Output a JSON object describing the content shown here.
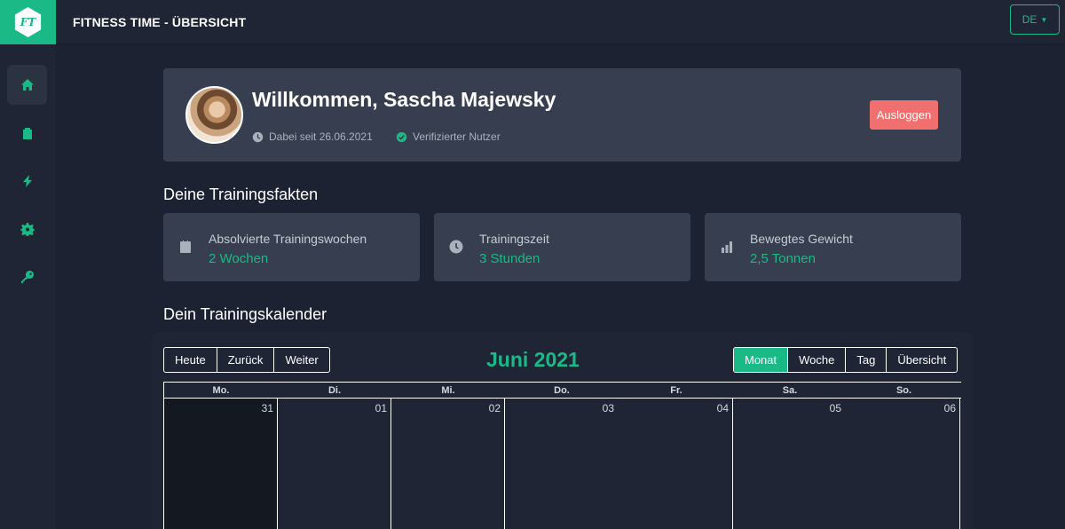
{
  "app": {
    "logo_text": "FT",
    "title": "FITNESS TIME - ÜBERSICHT",
    "language": "DE"
  },
  "sidebar": {
    "items": [
      {
        "icon": "home-icon",
        "active": true
      },
      {
        "icon": "clipboard-icon",
        "active": false
      },
      {
        "icon": "bolt-icon",
        "active": false
      },
      {
        "icon": "gear-icon",
        "active": false
      },
      {
        "icon": "key-icon",
        "active": false
      }
    ]
  },
  "welcome": {
    "title": "Willkommen, Sascha Majewsky",
    "member_since": "Dabei seit 26.06.2021",
    "verified": "Verifizierter Nutzer",
    "logout_label": "Ausloggen"
  },
  "facts": {
    "heading": "Deine Trainingsfakten",
    "items": [
      {
        "icon": "calendar-icon",
        "label": "Absolvierte Trainingswochen",
        "value": "2 Wochen"
      },
      {
        "icon": "clock-icon",
        "label": "Trainingszeit",
        "value": "3 Stunden"
      },
      {
        "icon": "bar-chart-icon",
        "label": "Bewegtes Gewicht",
        "value": "2,5 Tonnen"
      }
    ]
  },
  "calendar": {
    "heading": "Dein Trainingskalender",
    "title": "Juni 2021",
    "nav": {
      "today": "Heute",
      "back": "Zurück",
      "next": "Weiter"
    },
    "views": {
      "month": "Monat",
      "week": "Woche",
      "day": "Tag",
      "overview": "Übersicht",
      "active": "Monat"
    },
    "weekdays": [
      "Mo.",
      "Di.",
      "Mi.",
      "Do.",
      "Fr.",
      "Sa.",
      "So."
    ],
    "days": [
      "31",
      "01",
      "02",
      "03",
      "04",
      "05",
      "06"
    ]
  },
  "colors": {
    "accent": "#1ab985",
    "danger": "#f0706f",
    "card": "#363e4f",
    "background": "#1c2231"
  }
}
